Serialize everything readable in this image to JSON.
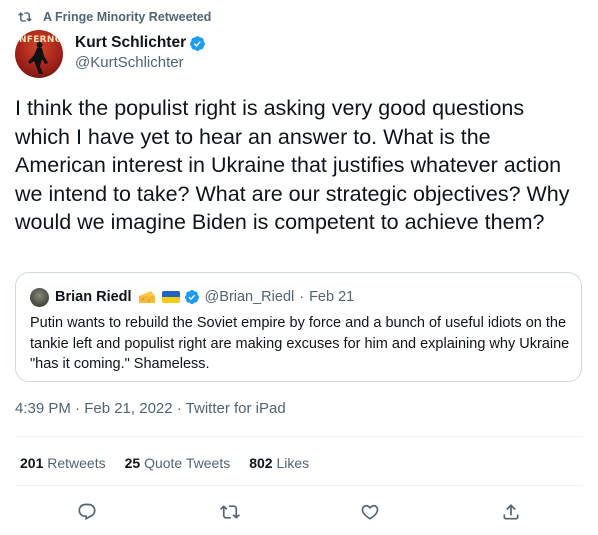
{
  "retweet": {
    "text": "A Fringe Minority Retweeted",
    "icon": "retweet-icon"
  },
  "author": {
    "display_name": "Kurt Schlichter",
    "handle": "@KurtSchlichter",
    "verified": true,
    "avatar_text": "INFERNO"
  },
  "tweet": {
    "text": "I think the populist right is asking very good questions which I have yet to hear an answer to. What is the American interest in Ukraine that justifies whatever action we intend to take? What are our strategic objectives? Why would we imagine Biden is competent to achieve them?"
  },
  "quote": {
    "display_name": "Brian Riedl",
    "handle": "@Brian_Riedl",
    "separator": "·",
    "date": "Feb 21",
    "emojis": [
      "cheese-icon",
      "ukraine-flag-icon"
    ],
    "verified": true,
    "text": "Putin wants to rebuild the Soviet empire by force and a bunch of useful idiots on the tankie left and populist right are making excuses for him and explaining why Ukraine \"has it coming.\" Shameless."
  },
  "meta": {
    "timestamp": "4:39 PM · Feb 21, 2022 · Twitter for iPad"
  },
  "stats": {
    "retweets": {
      "count": "201",
      "label": "Retweets"
    },
    "quotes": {
      "count": "25",
      "label": "Quote Tweets"
    },
    "likes": {
      "count": "802",
      "label": "Likes"
    }
  },
  "actions": [
    "reply-icon",
    "retweet-icon",
    "like-icon",
    "share-icon"
  ],
  "colors": {
    "text": "#0f1419",
    "secondary": "#536471",
    "verified": "#1d9bf0",
    "border": "#cfd9de",
    "divider": "#eff3f4"
  }
}
